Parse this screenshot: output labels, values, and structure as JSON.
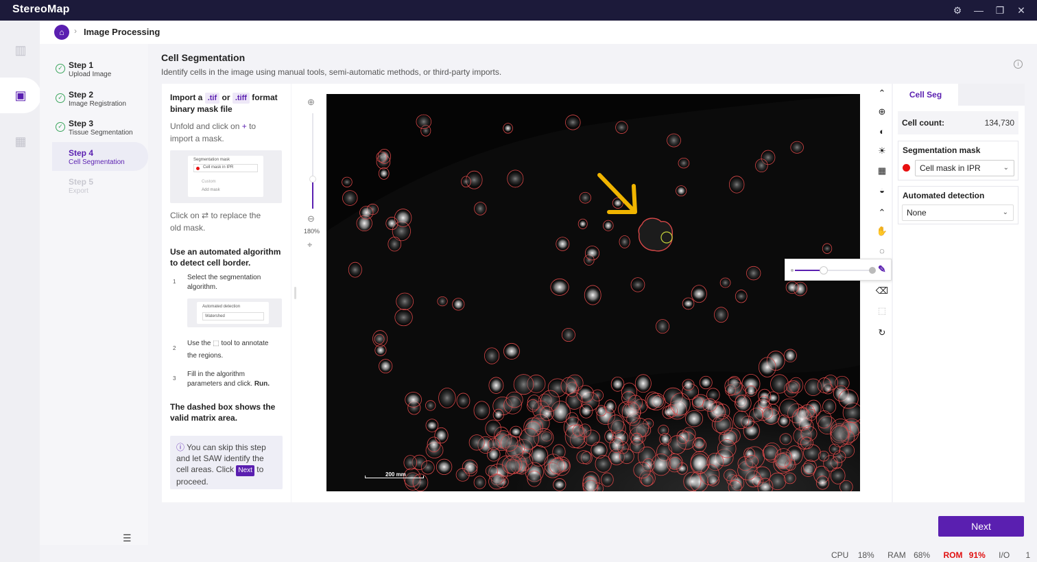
{
  "app": {
    "title": "StereoMap"
  },
  "breadcrumb": {
    "current": "Image Processing"
  },
  "steps": [
    {
      "title": "Step 1",
      "sub": "Upload Image",
      "state": "done"
    },
    {
      "title": "Step 2",
      "sub": "Image Registration",
      "state": "done"
    },
    {
      "title": "Step 3",
      "sub": "Tissue Segmentation",
      "state": "done"
    },
    {
      "title": "Step 4",
      "sub": "Cell Segmentation",
      "state": "active"
    },
    {
      "title": "Step 5",
      "sub": "Export",
      "state": "disabled"
    }
  ],
  "header": {
    "title": "Cell Segmentation",
    "subtitle": "Identify cells in the image using manual tools, semi-automatic methods, or third-party imports."
  },
  "guide": {
    "import_pre": "Import a",
    "tif": ".tif",
    "or": "or",
    "tiff": ".tiff",
    "format": "format",
    "binary": "binary mask file",
    "unfold": "Unfold and click on",
    "plus": "+",
    "to": "to",
    "import_mask": "import a mask.",
    "thumb1": {
      "title": "Segmentation mask",
      "sel": "Cell mask in IPR",
      "custom": "Custom",
      "add": "Add mask"
    },
    "click_on": "Click on",
    "replace_icon": "⇄",
    "replace": "to replace the",
    "old_mask": "old mask.",
    "algo_heading_1": "Use an automated algorithm",
    "algo_heading_2": "to detect cell border.",
    "s1_num": "1",
    "s1_a": "Select the segmentation",
    "s1_b": "algorithm.",
    "thumb2": {
      "title": "Automated detection",
      "sel": "Watershed"
    },
    "s2_num": "2",
    "s2_a": "Use the",
    "s2_b": "tool to annotate",
    "s2_c": "the regions.",
    "s3_num": "3",
    "s3_a": "Fill in the algorithm",
    "s3_b": "parameters and click.",
    "s3_run": "Run.",
    "dashed_1": "The dashed box shows the",
    "dashed_2": "valid matrix area.",
    "note_1": "You can skip this step",
    "note_2": "and let SAW identify the",
    "note_3": "cell areas. Click",
    "note_next": "Next",
    "note_to": "to",
    "note_4": "proceed."
  },
  "zoom": {
    "level": "180%"
  },
  "image": {
    "scale_bar": "200 mm"
  },
  "brush": {
    "size_fraction": 0.38
  },
  "panel": {
    "tab": "Cell Seg",
    "cell_count_label": "Cell count:",
    "cell_count": "134,730",
    "mask_label": "Segmentation mask",
    "mask_value": "Cell mask in IPR",
    "mask_color": "#e81010",
    "auto_label": "Automated detection",
    "auto_value": "None"
  },
  "next_label": "Next",
  "status": {
    "cpu_label": "CPU",
    "cpu": "18%",
    "ram_label": "RAM",
    "ram": "68%",
    "rom_label": "ROM",
    "rom": "91%",
    "io_label": "I/O",
    "io": "1"
  },
  "colors": {
    "accent": "#5a1fb0",
    "annotation": "#f0b400",
    "cell_outline": "#d84848"
  }
}
